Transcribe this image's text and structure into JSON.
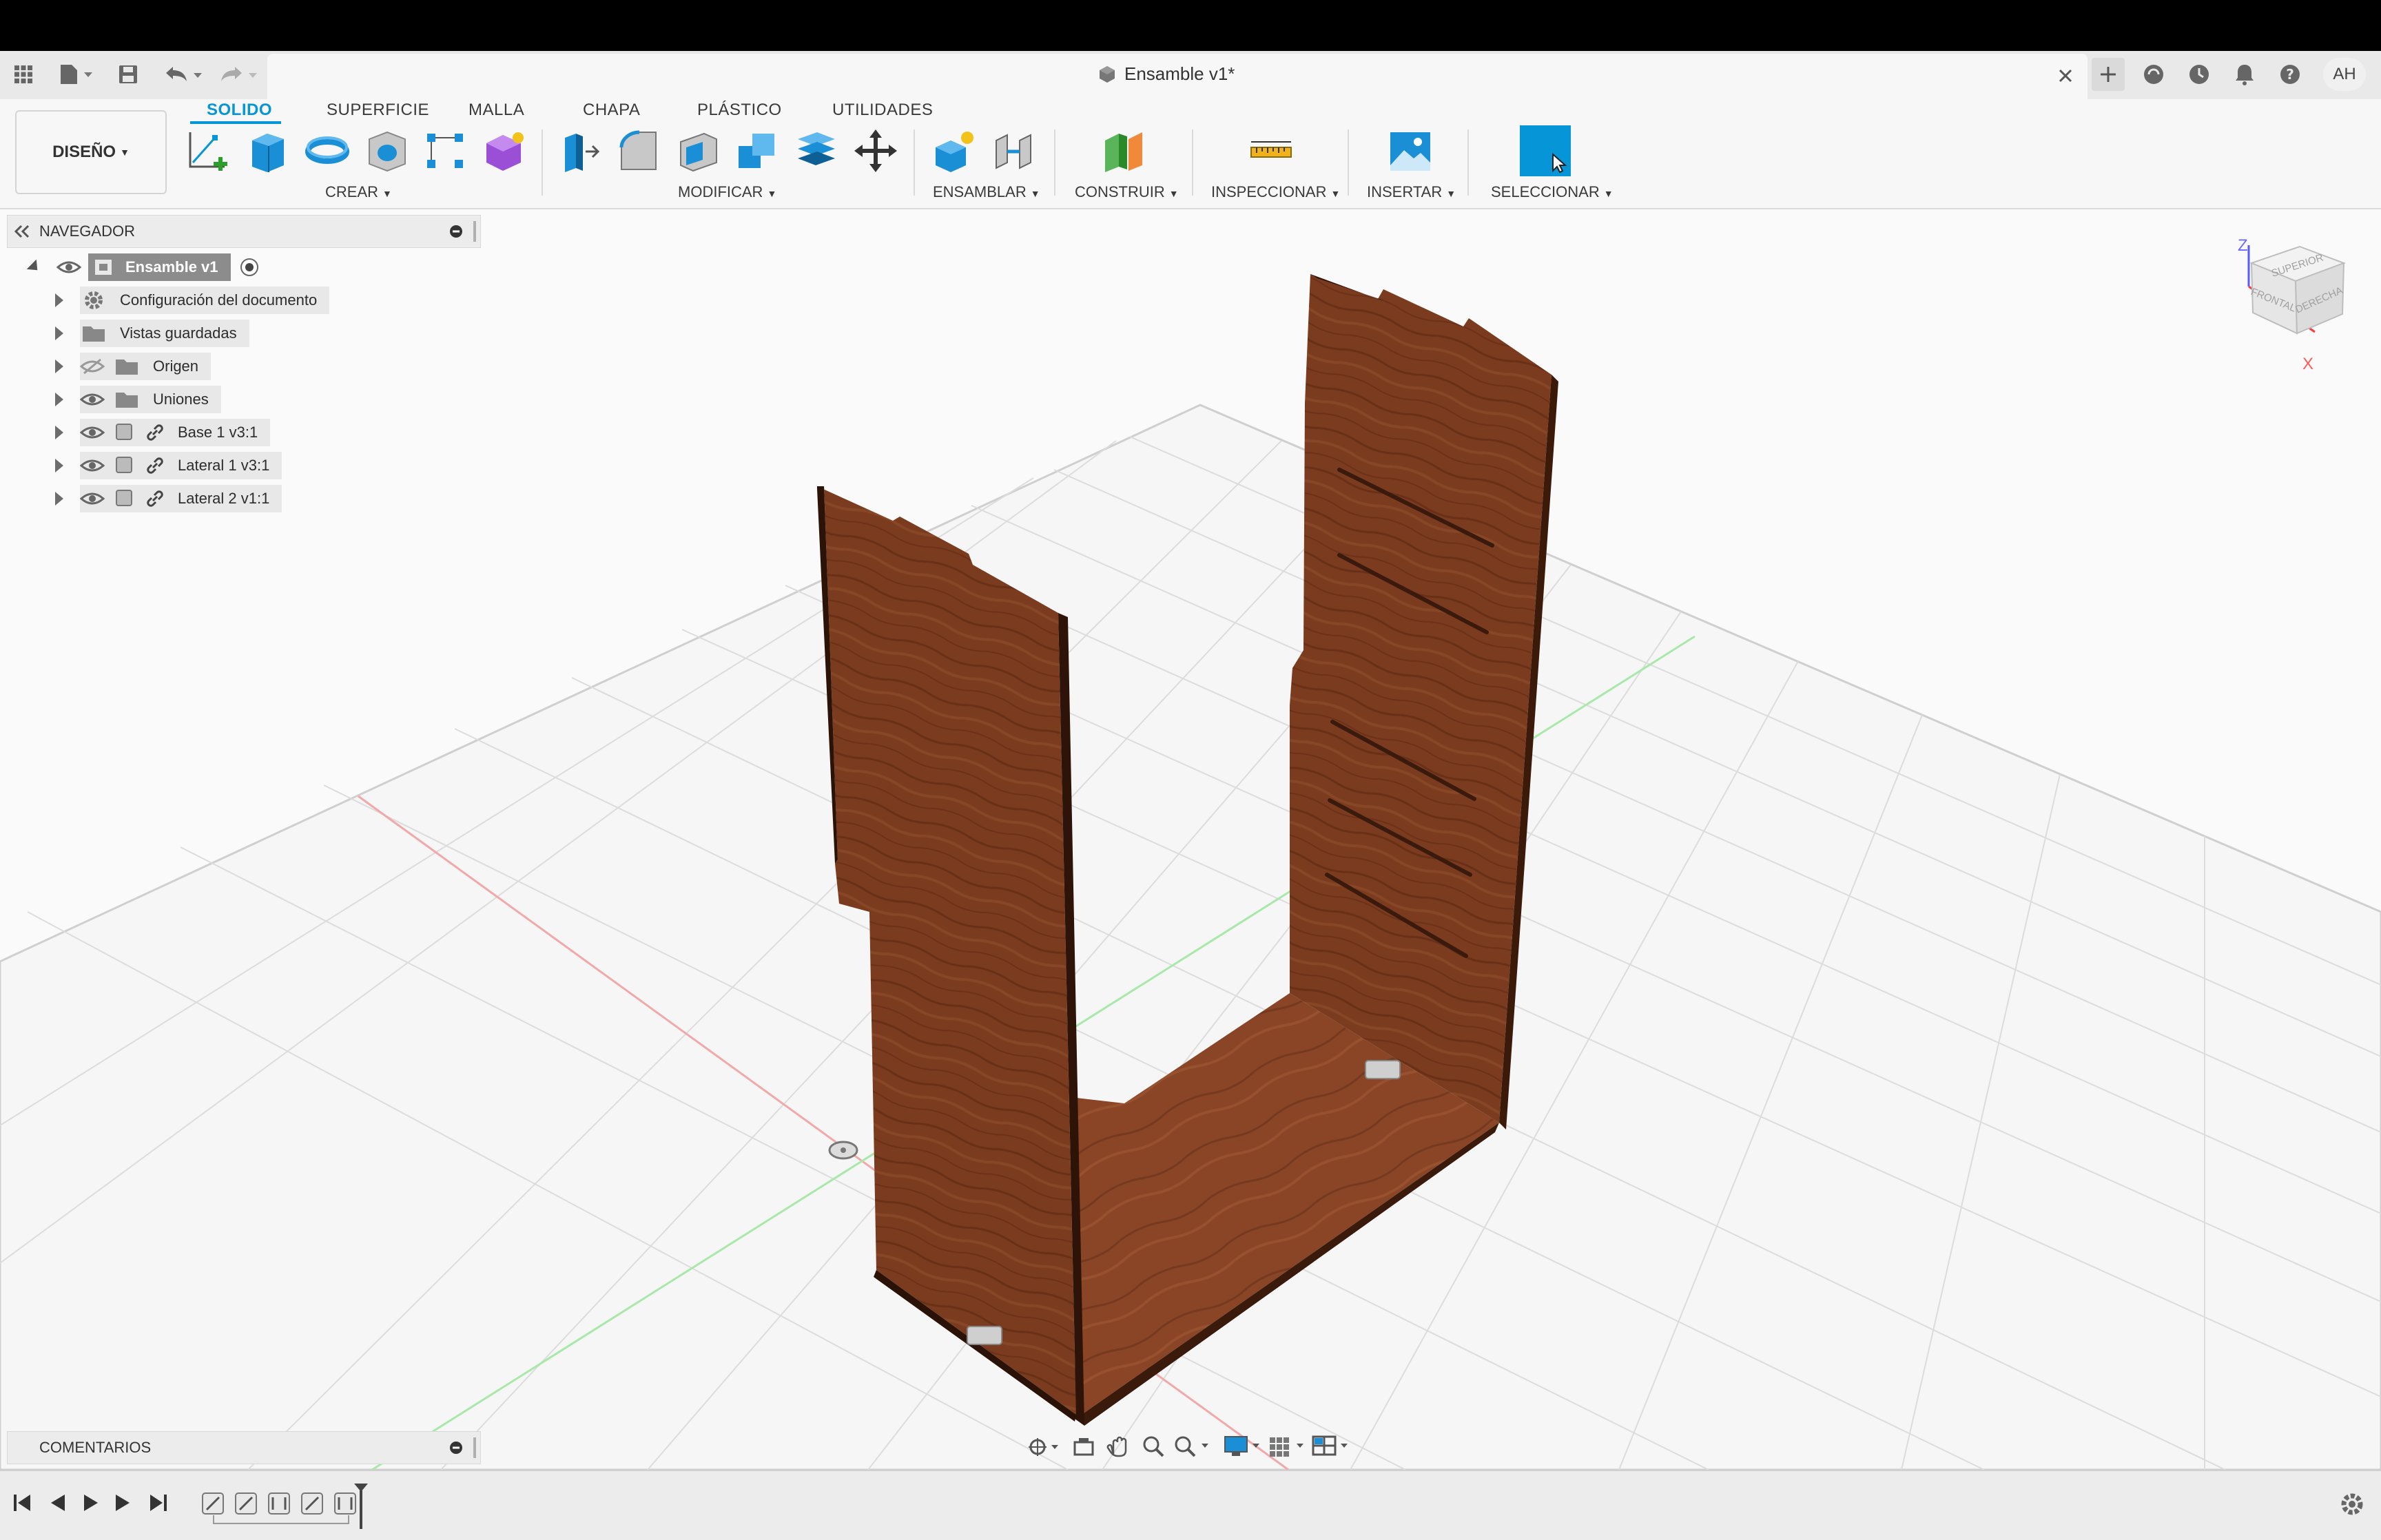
{
  "window": {
    "title": "Ensamble v1*",
    "user_initials": "AH"
  },
  "workspace": {
    "label": "DISEÑO"
  },
  "tabs": [
    {
      "label": "SOLIDO",
      "active": true
    },
    {
      "label": "SUPERFICIE"
    },
    {
      "label": "MALLA"
    },
    {
      "label": "CHAPA"
    },
    {
      "label": "PLÁSTICO"
    },
    {
      "label": "UTILIDADES"
    }
  ],
  "groups": {
    "crear": "CREAR",
    "modificar": "MODIFICAR",
    "ensamblar": "ENSAMBLAR",
    "construir": "CONSTRUIR",
    "inspeccionar": "INSPECCIONAR",
    "insertar": "INSERTAR",
    "seleccionar": "SELECCIONAR"
  },
  "navigator": {
    "title": "NAVEGADOR",
    "root": "Ensamble v1",
    "items": [
      {
        "label": "Configuración del documento"
      },
      {
        "label": "Vistas guardadas"
      },
      {
        "label": "Origen"
      },
      {
        "label": "Uniones"
      },
      {
        "label": "Base 1 v3:1"
      },
      {
        "label": "Lateral 1 v3:1"
      },
      {
        "label": "Lateral 2 v1:1"
      }
    ]
  },
  "comments": {
    "title": "COMENTARIOS"
  },
  "viewcube": {
    "faces": [
      "SUPERIOR",
      "FRONTAL",
      "DERECHA"
    ],
    "axes": [
      "Z",
      "X"
    ]
  },
  "colors": {
    "accent": "#0696d7",
    "wood": "#7a3a1f",
    "topbar": "#000000"
  }
}
